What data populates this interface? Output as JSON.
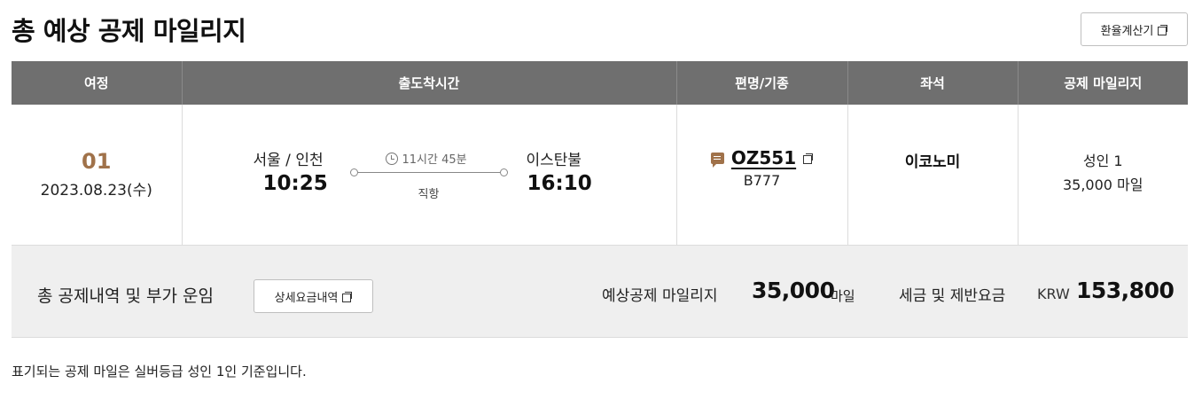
{
  "title": "총 예상 공제 마일리지",
  "exchange_button": "환율계산기",
  "table": {
    "headers": [
      "여정",
      "출도착시간",
      "편명/기종",
      "좌석",
      "공제 마일리지"
    ],
    "row": {
      "segment_no": "01",
      "date": "2023.08.23(수)",
      "departure": {
        "city": "서울 / 인천",
        "time": "10:25"
      },
      "duration": "11시간 45분",
      "stop_type": "직항",
      "arrival": {
        "city": "이스탄불",
        "time": "16:10"
      },
      "flight_no": "OZ551",
      "aircraft": "B777",
      "cabin": "이코노미",
      "passengers": "성인 1",
      "mileage": "35,000 마일"
    }
  },
  "summary": {
    "label": "총 공제내역 및 부가 운임",
    "detail_button": "상세요금내역",
    "expected_label": "예상공제 마일리지",
    "expected_value": "35,000",
    "expected_unit": "마일",
    "tax_label": "세금 및 제반요금",
    "tax_currency": "KRW",
    "tax_value": "153,800"
  },
  "footnote": "표기되는 공제 마일은 실버등급 성인 1인 기준입니다.",
  "colors": {
    "header_bg": "#6f6f6f",
    "accent": "#a0724a",
    "summary_bg": "#efefef"
  },
  "icons": [
    "copy-icon",
    "clock-icon",
    "memo-icon"
  ]
}
